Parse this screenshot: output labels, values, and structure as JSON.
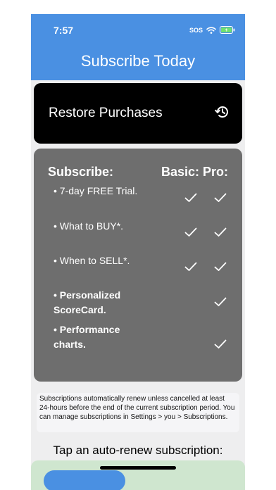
{
  "status": {
    "time": "7:57",
    "sos": "SOS"
  },
  "header": {
    "title": "Subscribe Today"
  },
  "restore": {
    "label": "Restore Purchases",
    "icon": "history-icon"
  },
  "plans": {
    "heading": "Subscribe:",
    "tiers": "Basic: Pro:",
    "features": [
      {
        "text": "• 7-day FREE Trial.",
        "basic": true,
        "pro": true
      },
      {
        "text": "• What to BUY*.",
        "basic": true,
        "pro": true
      },
      {
        "text": "• When to SELL*.",
        "basic": true,
        "pro": true
      },
      {
        "text": "• Personalized ScoreCard.",
        "basic": false,
        "pro": true
      },
      {
        "text": "• Performance charts.",
        "basic": false,
        "pro": true
      }
    ]
  },
  "note": {
    "text": "Subscriptions automatically renew unless cancelled at least 24-hours before the end of the current subscription period. You can manage subscriptions in Settings > you > Subscriptions."
  },
  "cta": {
    "text": "Tap an auto-renew subscription:"
  },
  "colors": {
    "header": "#4a90e2",
    "card": "#6e6e6e",
    "restore": "#000000",
    "plan_bg": "#cfe6cf"
  }
}
